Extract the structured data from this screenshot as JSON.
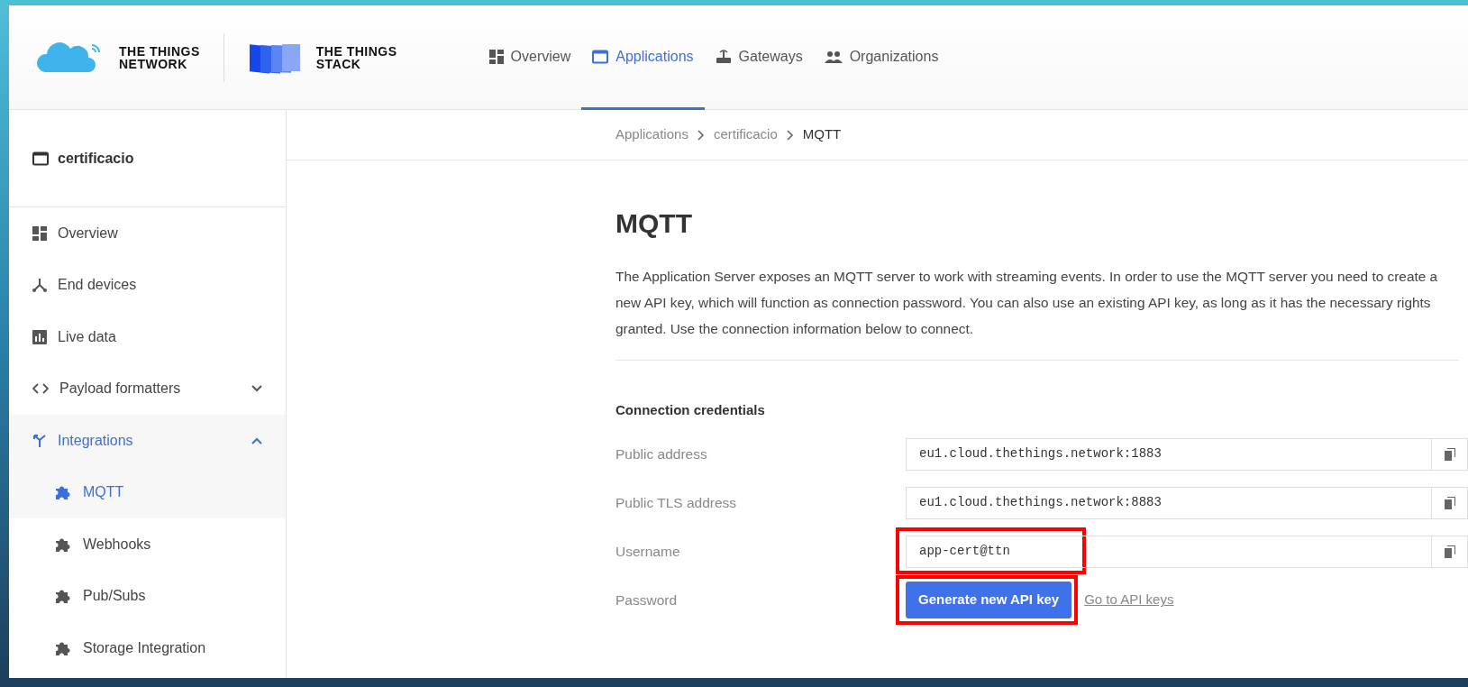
{
  "brand": [
    {
      "line1": "THE THINGS",
      "line2": "NETWORK"
    },
    {
      "line1": "THE THINGS",
      "line2": "STACK"
    }
  ],
  "nav": [
    {
      "label": "Overview",
      "selected": false
    },
    {
      "label": "Applications",
      "selected": true
    },
    {
      "label": "Gateways",
      "selected": false
    },
    {
      "label": "Organizations",
      "selected": false
    }
  ],
  "sidebar": {
    "title": "certificacio",
    "items": [
      {
        "label": "Overview",
        "selected": false
      },
      {
        "label": "End devices",
        "selected": false
      },
      {
        "label": "Live data",
        "selected": false
      },
      {
        "label": "Payload formatters",
        "selected": false,
        "expanded": false
      },
      {
        "label": "Integrations",
        "selected": true,
        "expanded": true,
        "children": [
          {
            "label": "MQTT",
            "selected": true
          },
          {
            "label": "Webhooks",
            "selected": false
          },
          {
            "label": "Pub/Subs",
            "selected": false
          },
          {
            "label": "Storage Integration",
            "selected": false
          }
        ]
      }
    ]
  },
  "breadcrumb": [
    "Applications",
    "certificacio",
    "MQTT"
  ],
  "title": "MQTT",
  "description": "The Application Server exposes an MQTT server to work with streaming events. In order to use the MQTT server you need to create a new API key, which will function as connection password. You can also use an existing API key, as long as it has the necessary rights granted. Use the connection information below to connect.",
  "section_title": "Connection credentials",
  "rows": [
    {
      "kind": "field",
      "label": "Public address",
      "value": "eu1.cloud.thethings.network:1883",
      "highlighted": false
    },
    {
      "kind": "field",
      "label": "Public TLS address",
      "value": "eu1.cloud.thethings.network:8883",
      "highlighted": false
    },
    {
      "kind": "field",
      "label": "Username",
      "value": "app-cert@ttn",
      "highlighted": true
    },
    {
      "kind": "actions",
      "label": "Password",
      "button": "Generate new API key",
      "highlighted": true,
      "link": "Go to API keys"
    }
  ]
}
